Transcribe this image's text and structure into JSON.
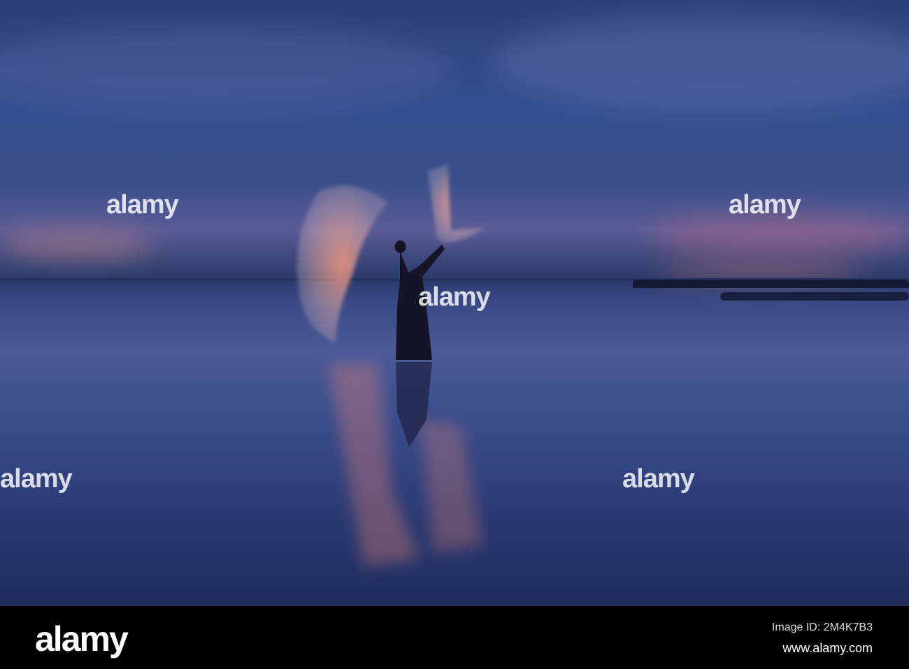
{
  "watermark": {
    "text": "alamy"
  },
  "footer": {
    "logo": "alamy",
    "image_id": "Image ID: 2M4K7B3",
    "website": "www.alamy.com"
  }
}
